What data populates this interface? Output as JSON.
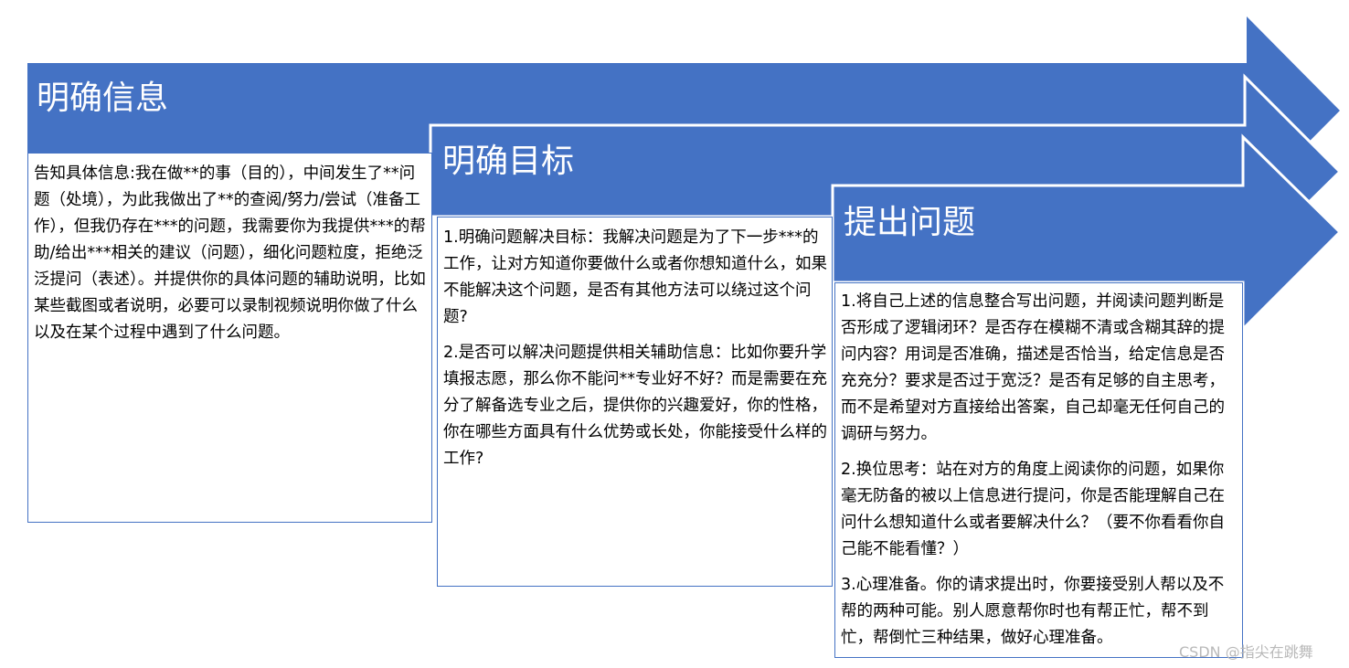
{
  "colors": {
    "arrow_fill": "#4472c4",
    "arrow_outline": "#ffffff",
    "box_border": "#4472c4",
    "watermark": "#b9b9b9"
  },
  "steps": [
    {
      "title": "明确信息",
      "paragraphs": [
        "告知具体信息:我在做**的事（目的），中间发生了**问题（处境），为此我做出了**的查阅/努力/尝试（准备工作），但我仍存在***的问题，我需要你为我提供***的帮助/给出***相关的建议（问题），细化问题粒度，拒绝泛泛提问（表述）。并提供你的具体问题的辅助说明，比如某些截图或者说明，必要可以录制视频说明你做了什么以及在某个过程中遇到了什么问题。"
      ]
    },
    {
      "title": "明确目标",
      "paragraphs": [
        "1.明确问题解决目标：我解决问题是为了下一步***的工作，让对方知道你要做什么或者你想知道什么，如果不能解决这个问题，是否有其他方法可以绕过这个问题?",
        "2.是否可以解决问题提供相关辅助信息：比如你要升学填报志愿，那么你不能问**专业好不好？而是需要在充分了解备选专业之后，提供你的兴趣爱好，你的性格，你在哪些方面具有什么优势或长处，你能接受什么样的工作?"
      ]
    },
    {
      "title": "提出问题",
      "paragraphs": [
        "1.将自己上述的信息整合写出问题，并阅读问题判断是否形成了逻辑闭环？是否存在模糊不清或含糊其辞的提问内容？用词是否准确，描述是否恰当，给定信息是否充充分？要求是否过于宽泛？是否有足够的自主思考，而不是希望对方直接给出答案，自己却毫无任何自己的调研与努力。",
        "2.换位思考：站在对方的角度上阅读你的问题，如果你毫无防备的被以上信息进行提问，你是否能理解自己在问什么想知道什么或者要解决什么？（要不你看看你自己能不能看懂？）",
        "3.心理准备。你的请求提出时，你要接受别人帮以及不帮的两种可能。别人愿意帮你时也有帮正忙，帮不到忙，帮倒忙三种结果，做好心理准备。"
      ]
    }
  ],
  "watermark": "CSDN @指尖在跳舞"
}
